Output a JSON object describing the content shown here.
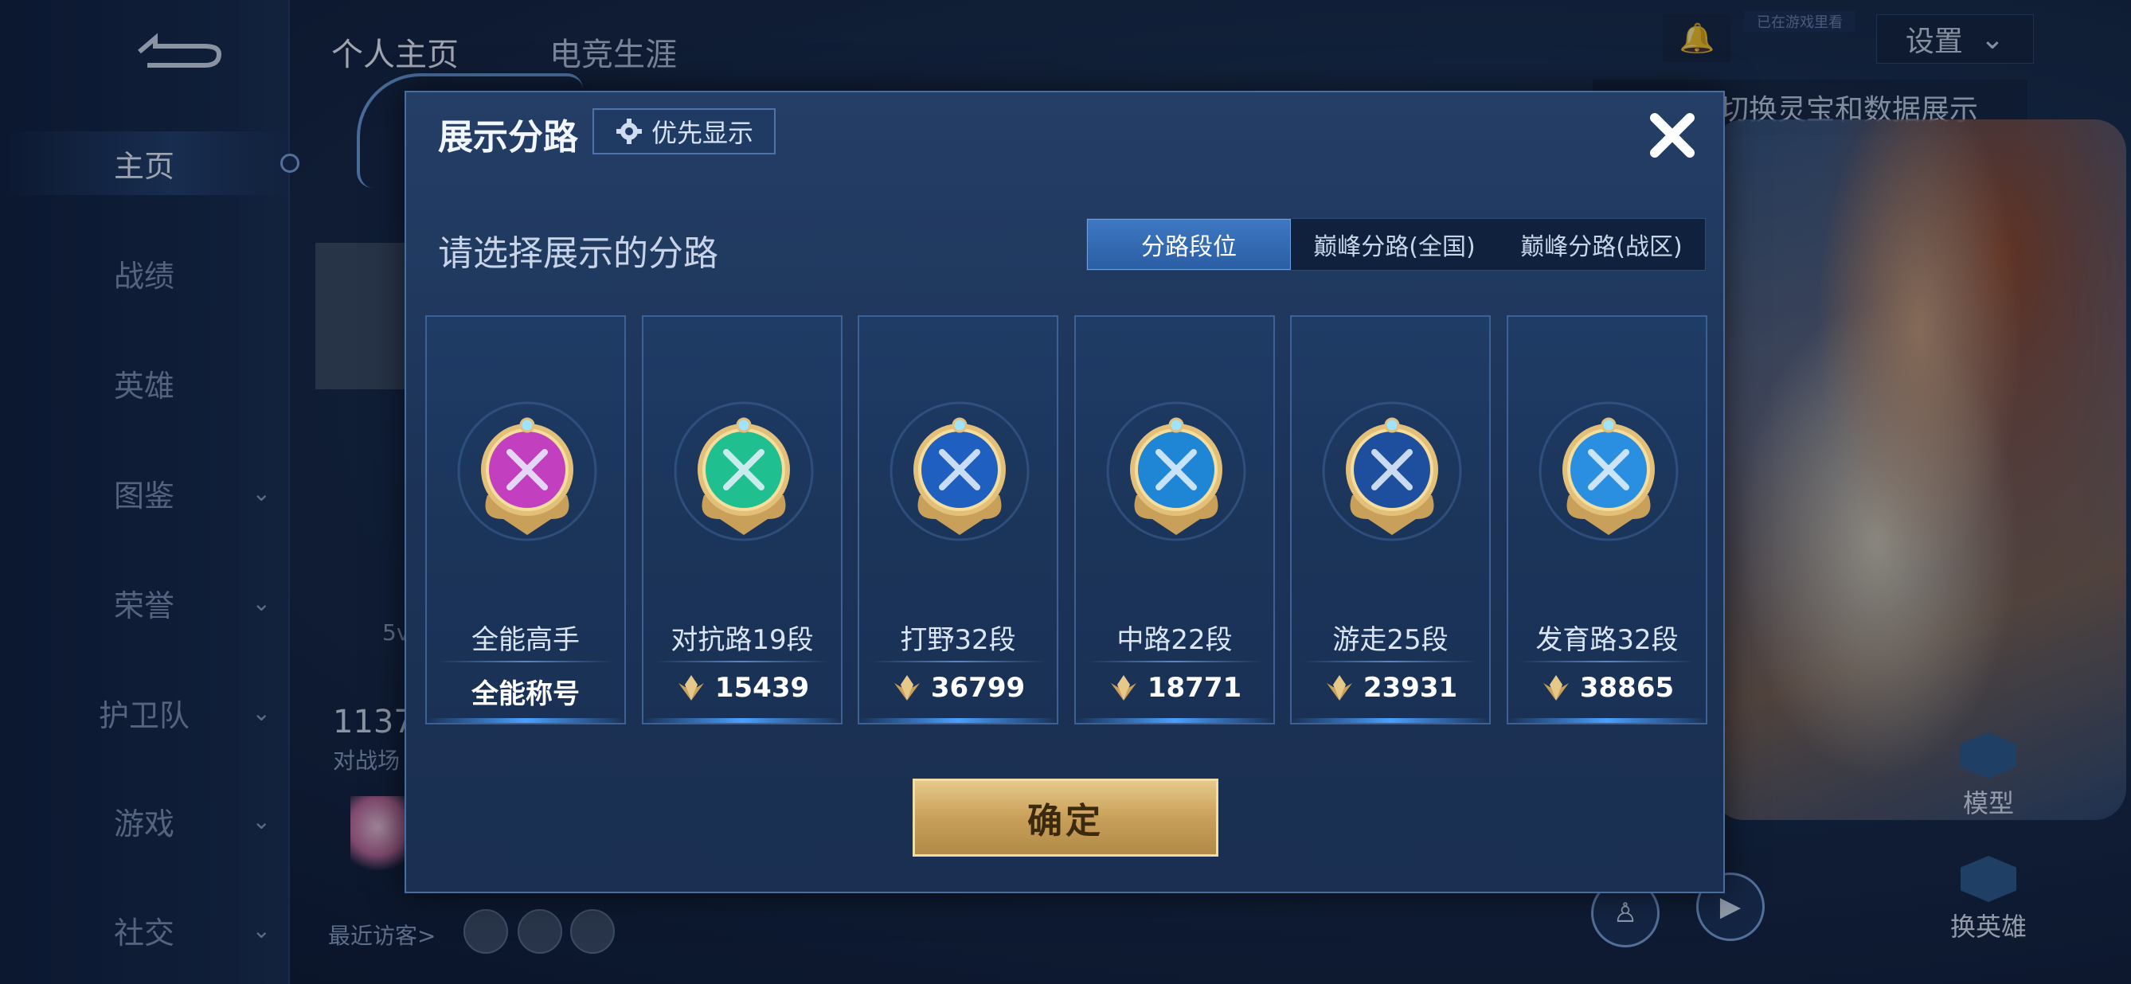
{
  "background": {
    "sidebar": {
      "items": [
        {
          "label": "主页",
          "active": true,
          "has_chevron": false
        },
        {
          "label": "战绩",
          "active": false,
          "has_chevron": false
        },
        {
          "label": "英雄",
          "active": false,
          "has_chevron": false
        },
        {
          "label": "图鉴",
          "active": false,
          "has_chevron": true
        },
        {
          "label": "荣誉",
          "active": false,
          "has_chevron": true
        },
        {
          "label": "护卫队",
          "active": false,
          "has_chevron": true
        },
        {
          "label": "游戏",
          "active": false,
          "has_chevron": true
        },
        {
          "label": "社交",
          "active": false,
          "has_chevron": true
        }
      ]
    },
    "top_tabs": [
      {
        "label": "个人主页",
        "active": true
      },
      {
        "label": "电竞生涯",
        "active": false
      }
    ],
    "bell_label": "已在游戏里看",
    "settings_label": "设置",
    "hint_text": "切换灵宝和数据展示",
    "profile_number": "1137",
    "profile_sub": "对战场",
    "profile_five": "5v",
    "recent_visitors": "最近访客>",
    "model_label": "模型",
    "switch_hero_label": "换英雄"
  },
  "modal": {
    "title": "展示分路",
    "priority_label": "优先显示",
    "prompt": "请选择展示的分路",
    "tabs": [
      {
        "label": "分路段位",
        "active": true
      },
      {
        "label": "巅峰分路(全国)",
        "active": false
      },
      {
        "label": "巅峰分路(战区)",
        "active": false
      }
    ],
    "cards": [
      {
        "name": "全能高手",
        "score": "全能称号",
        "emblem": "all-round-emblem-icon",
        "color": "#c23fbf"
      },
      {
        "name": "对抗路19段",
        "score": "15439",
        "emblem": "clash-lane-emblem-icon",
        "color": "#1fbf8f"
      },
      {
        "name": "打野32段",
        "score": "36799",
        "emblem": "jungle-emblem-icon",
        "color": "#1f5fbf"
      },
      {
        "name": "中路22段",
        "score": "18771",
        "emblem": "mid-lane-emblem-icon",
        "color": "#1f86d6"
      },
      {
        "name": "游走25段",
        "score": "23931",
        "emblem": "roam-emblem-icon",
        "color": "#1e4f9e"
      },
      {
        "name": "发育路32段",
        "score": "38865",
        "emblem": "farm-lane-emblem-icon",
        "color": "#2a8fe0"
      }
    ],
    "confirm_label": "确定"
  }
}
